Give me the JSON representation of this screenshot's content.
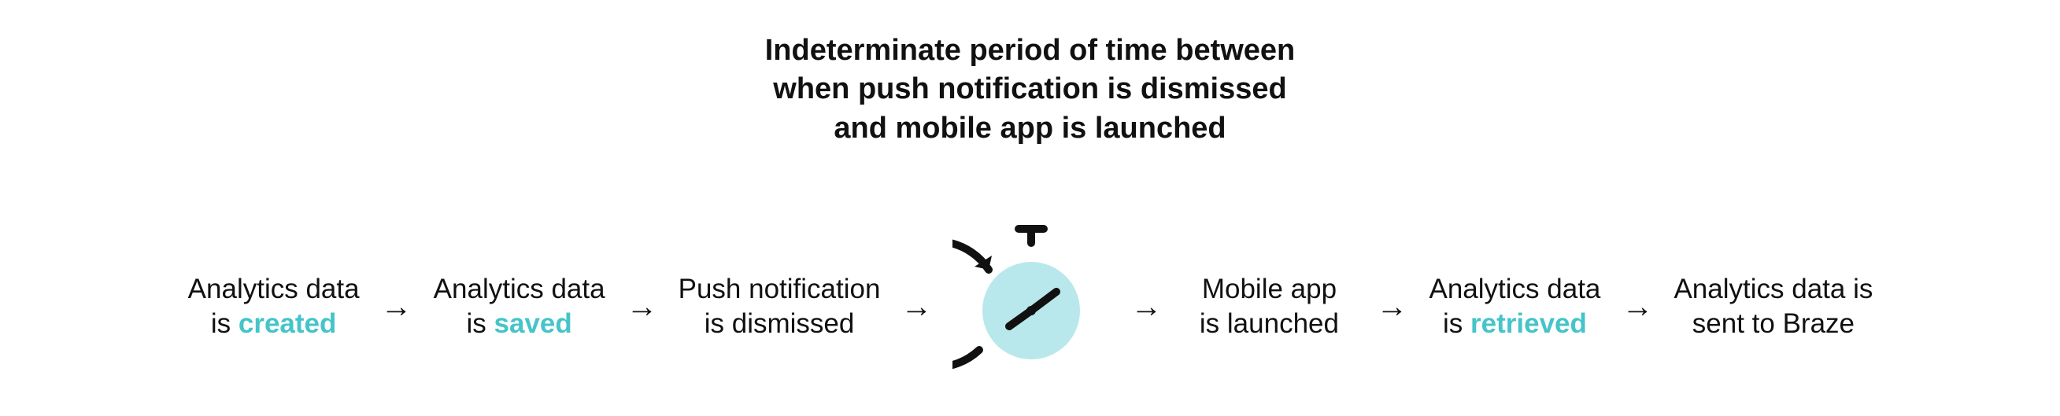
{
  "caption": {
    "line1": "Indeterminate period of time between",
    "line2": "when push notification is dismissed",
    "line3": "and mobile app is launched"
  },
  "flow": {
    "steps": [
      {
        "line1": "Analytics data",
        "line2_pre": "is ",
        "line2_hl": "created",
        "line2_post": ""
      },
      {
        "line1": "Analytics data",
        "line2_pre": "is ",
        "line2_hl": "saved",
        "line2_post": ""
      },
      {
        "line1": "Push notification",
        "line2_pre": "is dismissed",
        "line2_hl": "",
        "line2_post": ""
      },
      {
        "icon": "stopwatch"
      },
      {
        "line1": "Mobile app",
        "line2_pre": "is launched",
        "line2_hl": "",
        "line2_post": ""
      },
      {
        "line1": "Analytics data",
        "line2_pre": "is ",
        "line2_hl": "retrieved",
        "line2_post": ""
      },
      {
        "line1": "Analytics data is",
        "line2_pre": "sent to Braze",
        "line2_hl": "",
        "line2_post": ""
      }
    ],
    "arrow_glyph": "→"
  },
  "colors": {
    "highlight": "#45c4c9",
    "clock_face": "#b8e8ec",
    "stroke": "#111111",
    "bg": "#ffffff"
  }
}
